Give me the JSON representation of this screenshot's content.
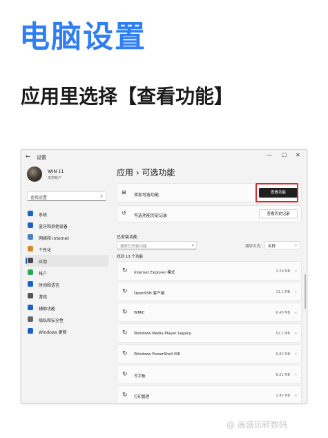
{
  "hero": {
    "title": "电脑设置",
    "subtitle": "应用里选择【查看功能】"
  },
  "window": {
    "title": "设置",
    "controls": {
      "minimize": "—",
      "maximize": "☐",
      "close": "✕"
    }
  },
  "profile": {
    "name": "WIN 11",
    "account": "本地帐户"
  },
  "search": {
    "placeholder": "查找设置"
  },
  "nav": [
    {
      "label": "系统",
      "icon": "monitor-icon",
      "color": "#1a62c5"
    },
    {
      "label": "蓝牙和其他设备",
      "icon": "bluetooth-icon",
      "color": "#1a62c5"
    },
    {
      "label": "网络和 Internet",
      "icon": "network-icon",
      "color": "#4a7fbf"
    },
    {
      "label": "个性化",
      "icon": "brush-icon",
      "color": "#d28a2a"
    },
    {
      "label": "应用",
      "icon": "apps-icon",
      "color": "#4a4a4a",
      "active": true
    },
    {
      "label": "帐户",
      "icon": "account-icon",
      "color": "#2aa85a"
    },
    {
      "label": "时间和语言",
      "icon": "globe-icon",
      "color": "#1a62c5"
    },
    {
      "label": "游戏",
      "icon": "gamepad-icon",
      "color": "#555555"
    },
    {
      "label": "辅助功能",
      "icon": "accessibility-icon",
      "color": "#1a62c5"
    },
    {
      "label": "隐私和安全性",
      "icon": "shield-icon",
      "color": "#666666"
    },
    {
      "label": "Windows 更新",
      "icon": "update-icon",
      "color": "#1a62c5"
    }
  ],
  "breadcrumb": "应用  ›  可选功能",
  "add_card": {
    "label": "添加可选功能",
    "button": "查看功能"
  },
  "history_card": {
    "label": "可选功能历史记录",
    "button": "查看历史记录"
  },
  "installed": {
    "section_title": "已安装功能",
    "filter_placeholder": "搜索已安装功能",
    "sort_label": "排序方式:",
    "sort_value": "名称",
    "found": "找到 13 个功能"
  },
  "features": [
    {
      "name": "Internet Explorer 模式",
      "size": "3.29 MB"
    },
    {
      "name": "OpenSSH 客户端",
      "size": "11.1 MB"
    },
    {
      "name": "WMIC",
      "size": "6.40 MB"
    },
    {
      "name": "Windows Media Player Legacy",
      "size": "52.2 MB"
    },
    {
      "name": "Windows PowerShell ISE",
      "size": "6.82 MB"
    },
    {
      "name": "写字板",
      "size": "6.21 MB"
    },
    {
      "name": "打印管理",
      "size": "2.45 MB"
    }
  ],
  "watermark": "@ 画盛玩转数码"
}
